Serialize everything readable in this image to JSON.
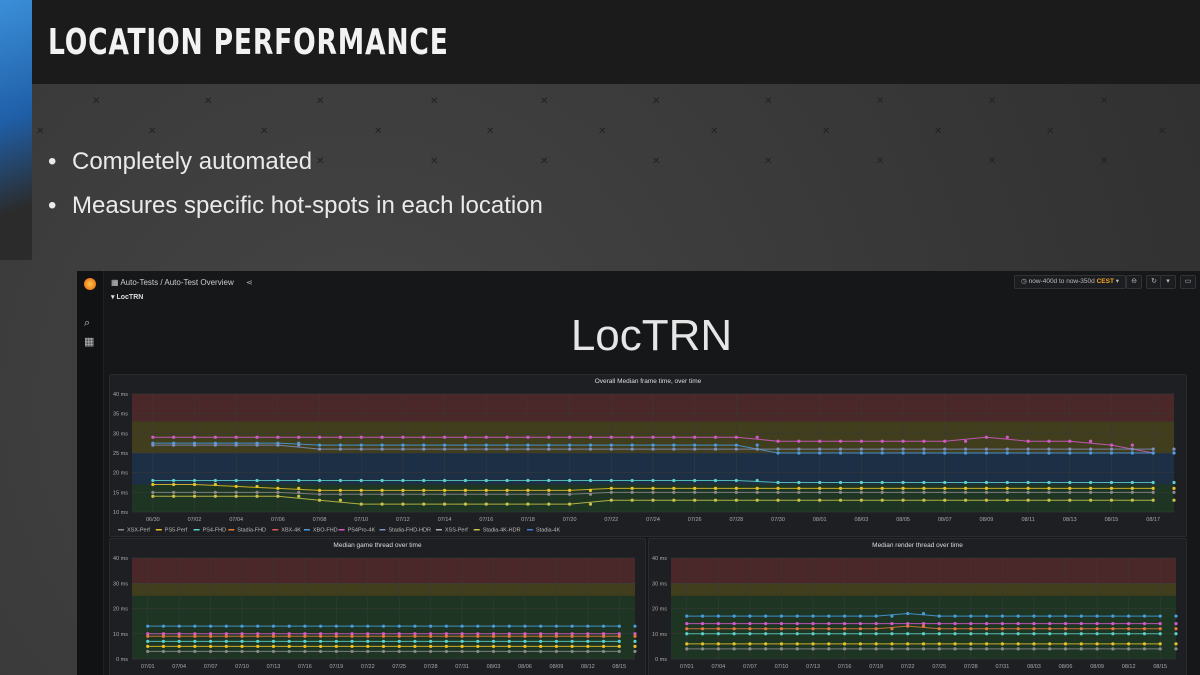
{
  "slide": {
    "title": "LOCATION PERFORMANCE",
    "bullets": [
      "Completely automated",
      "Measures specific hot-spots in each location"
    ]
  },
  "dashboard": {
    "breadcrumb": "Auto-Tests  /  Auto-Test Overview",
    "row_label": "LocTRN",
    "big_title": "LocTRN",
    "time_range": "now-400d to now-350d",
    "time_zone": "CEST",
    "colors": {
      "red_band": "#5a2b2b",
      "yellow_band": "#4d4a1e",
      "green_band": "#1f3d25",
      "blue_band": "#1d3650"
    }
  },
  "legend": [
    {
      "name": "XSX-Perf",
      "color": "#8a8a8a"
    },
    {
      "name": "PS5-Perf",
      "color": "#e6c229"
    },
    {
      "name": "PS4-FHD",
      "color": "#5ad1c9"
    },
    {
      "name": "Stadia-FHD",
      "color": "#e07b39"
    },
    {
      "name": "XBX-4K",
      "color": "#e05a5a"
    },
    {
      "name": "XBO-FHD",
      "color": "#4a9de0"
    },
    {
      "name": "PS4Pro-4K",
      "color": "#d25ac8"
    },
    {
      "name": "Stadia-FHD-HDR",
      "color": "#7e8fc0"
    },
    {
      "name": "XSS-Perf",
      "color": "#b0b0b0"
    },
    {
      "name": "Stadia-4K-HDR",
      "color": "#c9c34a"
    },
    {
      "name": "Stadia-4K",
      "color": "#3c7fd1"
    }
  ],
  "chart_data": [
    {
      "type": "line",
      "title": "Overall Median frame time, over time",
      "y_ticks": [
        "40 ms",
        "35 ms",
        "30 ms",
        "25 ms",
        "20 ms",
        "15 ms",
        "10 ms"
      ],
      "ylim": [
        10,
        40
      ],
      "x_ticks": [
        "06/30",
        "07/02",
        "07/04",
        "07/06",
        "07/08",
        "07/10",
        "07/12",
        "07/14",
        "07/16",
        "07/18",
        "07/20",
        "07/22",
        "07/24",
        "07/26",
        "07/28",
        "07/30",
        "08/01",
        "08/03",
        "08/05",
        "08/07",
        "08/09",
        "08/11",
        "08/13",
        "08/15",
        "08/17"
      ],
      "series": [
        {
          "name": "PS4Pro-4K",
          "values": [
            29,
            29,
            29,
            29,
            29,
            29,
            29,
            29,
            29,
            29,
            29,
            29,
            29,
            29,
            29,
            28,
            28,
            28,
            28,
            28,
            29,
            28,
            28,
            27,
            25
          ]
        },
        {
          "name": "XBO-FHD",
          "values": [
            27.5,
            27.5,
            27.5,
            27.5,
            27,
            27,
            27,
            27,
            27,
            27,
            27,
            27,
            27,
            27,
            27,
            25,
            25,
            25,
            25,
            25,
            25,
            25,
            25,
            25,
            25
          ]
        },
        {
          "name": "Stadia-FHD-HDR",
          "values": [
            27,
            27,
            27,
            27,
            26,
            26,
            26,
            26,
            26,
            26,
            26,
            26,
            26,
            26,
            26,
            26,
            26,
            26,
            26,
            26,
            26,
            26,
            26,
            26,
            26
          ]
        },
        {
          "name": "PS4-FHD",
          "values": [
            18,
            18,
            18,
            18,
            18,
            18,
            18,
            18,
            18,
            18,
            18,
            18,
            18,
            18,
            18,
            17.5,
            17.5,
            17.5,
            17.5,
            17.5,
            17.5,
            17.5,
            17.5,
            17.5,
            17.5
          ]
        },
        {
          "name": "PS5-Perf",
          "values": [
            17,
            17,
            16.5,
            16,
            15.5,
            15.5,
            15.5,
            15.5,
            15.5,
            15.5,
            15.5,
            16,
            16,
            16,
            16,
            16,
            16,
            16,
            16,
            16,
            16,
            16,
            16,
            16,
            16
          ]
        },
        {
          "name": "XSX-Perf",
          "values": [
            15,
            15,
            15,
            15,
            14.5,
            14.5,
            14.5,
            14.5,
            14.5,
            14.5,
            14.5,
            15,
            15,
            15,
            15,
            15,
            15,
            15,
            15,
            15,
            15,
            15,
            15,
            15,
            15
          ]
        },
        {
          "name": "Stadia-4K-HDR",
          "values": [
            14,
            14,
            14,
            14,
            13,
            12,
            12,
            12,
            12,
            12,
            12,
            13,
            13,
            13,
            13,
            13,
            13,
            13,
            13,
            13,
            13,
            13,
            13,
            13,
            13
          ]
        }
      ]
    },
    {
      "type": "line",
      "title": "Median game thread over time",
      "y_ticks": [
        "40 ms",
        "30 ms",
        "20 ms",
        "10 ms",
        "0 ms"
      ],
      "ylim": [
        0,
        40
      ],
      "x_ticks": [
        "07/01",
        "07/04",
        "07/07",
        "07/10",
        "07/13",
        "07/16",
        "07/19",
        "07/22",
        "07/25",
        "07/28",
        "07/31",
        "08/03",
        "08/06",
        "08/09",
        "08/12",
        "08/15"
      ],
      "series": [
        {
          "name": "XBO-FHD",
          "values": [
            13,
            13,
            13,
            13,
            13,
            13,
            13,
            13,
            13,
            13,
            13,
            13,
            13,
            13,
            13,
            13
          ]
        },
        {
          "name": "PS4Pro-4K",
          "values": [
            10,
            10,
            10,
            10,
            10,
            10,
            10,
            10,
            10,
            10,
            10,
            10,
            10,
            10,
            10,
            10
          ]
        },
        {
          "name": "Stadia-FHD",
          "values": [
            9,
            9,
            9,
            9,
            9,
            9,
            9,
            9,
            9,
            9,
            9,
            9,
            9,
            9,
            9,
            9
          ]
        },
        {
          "name": "PS4-FHD",
          "values": [
            7,
            7,
            7,
            7,
            7,
            7,
            7,
            7,
            7,
            7,
            7,
            7,
            7,
            7,
            7,
            7
          ]
        },
        {
          "name": "PS5-Perf",
          "values": [
            5,
            5,
            5,
            5,
            5,
            5,
            5,
            5,
            5,
            5,
            5,
            5,
            5,
            5,
            5,
            5
          ]
        },
        {
          "name": "XSX-Perf",
          "values": [
            3,
            3,
            3,
            3,
            3,
            3,
            3,
            3,
            3,
            3,
            3,
            3,
            3,
            3,
            3,
            3
          ]
        }
      ]
    },
    {
      "type": "line",
      "title": "Median render thread over time",
      "y_ticks": [
        "40 ms",
        "30 ms",
        "20 ms",
        "10 ms",
        "0 ms"
      ],
      "ylim": [
        0,
        40
      ],
      "x_ticks": [
        "07/01",
        "07/04",
        "07/07",
        "07/10",
        "07/13",
        "07/16",
        "07/19",
        "07/22",
        "07/25",
        "07/28",
        "07/31",
        "08/03",
        "08/06",
        "08/09",
        "08/12",
        "08/15"
      ],
      "series": [
        {
          "name": "XBO-FHD",
          "values": [
            17,
            17,
            17,
            17,
            17,
            17,
            17,
            18,
            17,
            17,
            17,
            17,
            17,
            17,
            17,
            17
          ]
        },
        {
          "name": "PS4Pro-4K",
          "values": [
            14,
            14,
            14,
            14,
            14,
            14,
            14,
            14,
            14,
            14,
            14,
            14,
            14,
            14,
            14,
            14
          ]
        },
        {
          "name": "Stadia-FHD",
          "values": [
            12,
            12,
            12,
            12,
            12,
            12,
            12,
            13,
            12,
            12,
            12,
            12,
            12,
            12,
            12,
            12
          ]
        },
        {
          "name": "PS4-FHD",
          "values": [
            10,
            10,
            10,
            10,
            10,
            10,
            10,
            10,
            10,
            10,
            10,
            10,
            10,
            10,
            10,
            10
          ]
        },
        {
          "name": "PS5-Perf",
          "values": [
            6,
            6,
            6,
            6,
            6,
            6,
            6,
            6,
            6,
            6,
            6,
            6,
            6,
            6,
            6,
            6
          ]
        },
        {
          "name": "XSX-Perf",
          "values": [
            4,
            4,
            4,
            4,
            4,
            4,
            4,
            4,
            4,
            4,
            4,
            4,
            4,
            4,
            4,
            4
          ]
        }
      ]
    }
  ]
}
